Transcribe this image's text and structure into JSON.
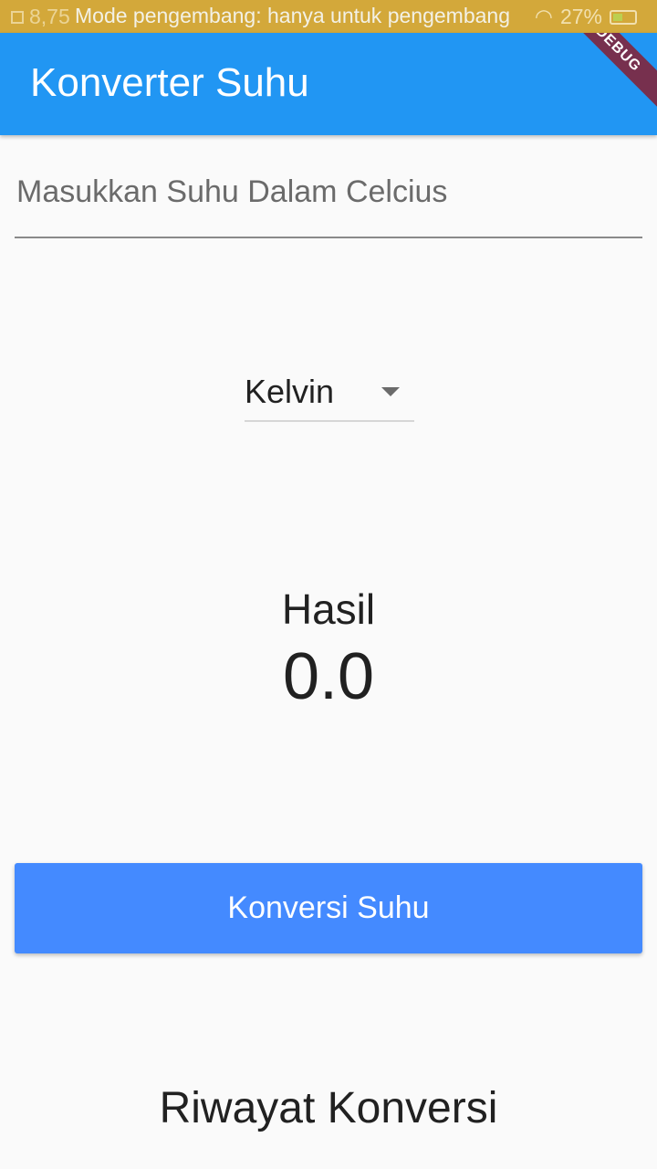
{
  "status_bar": {
    "left_text": "8,75",
    "notice": "Mode pengembang: hanya untuk pengembang",
    "battery": "27%"
  },
  "app_bar": {
    "title": "Konverter Suhu",
    "debug_label": "DEBUG",
    "color": "#2196f3"
  },
  "input": {
    "placeholder": "Masukkan Suhu Dalam Celcius",
    "value": ""
  },
  "unit_dropdown": {
    "selected": "Kelvin"
  },
  "result": {
    "label": "Hasil",
    "value": "0.0"
  },
  "convert_button": {
    "label": "Konversi Suhu",
    "color": "#448aff"
  },
  "history": {
    "title": "Riwayat Konversi"
  }
}
